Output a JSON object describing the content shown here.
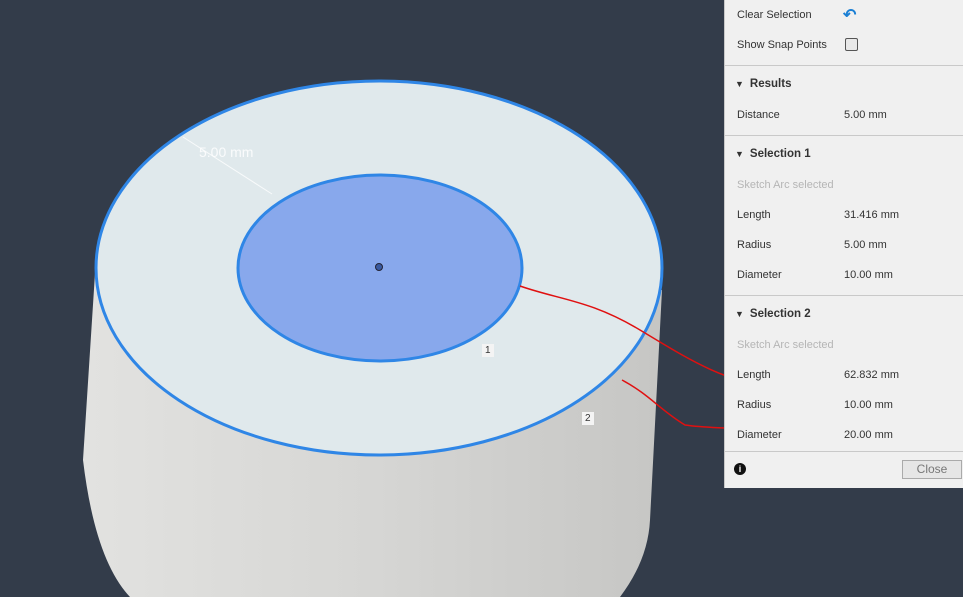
{
  "viewport": {
    "dimension_label": "5.00 mm",
    "edge_label_1": "1",
    "edge_label_2": "2",
    "accent": "#2f86e6"
  },
  "panel": {
    "clear_selection": "Clear Selection",
    "show_snap_points": "Show Snap Points",
    "show_snap_points_checked": false,
    "results": {
      "title": "Results",
      "distance_label": "Distance",
      "distance_value": "5.00 mm"
    },
    "selection1": {
      "title": "Selection 1",
      "status": "Sketch Arc selected",
      "length_label": "Length",
      "length_value": "31.416 mm",
      "radius_label": "Radius",
      "radius_value": "5.00 mm",
      "diameter_label": "Diameter",
      "diameter_value": "10.00 mm"
    },
    "selection2": {
      "title": "Selection 2",
      "status": "Sketch Arc selected",
      "length_label": "Length",
      "length_value": "62.832 mm",
      "radius_label": "Radius",
      "radius_value": "10.00 mm",
      "diameter_label": "Diameter",
      "diameter_value": "20.00 mm"
    },
    "info_icon": "i",
    "close_label": "Close"
  }
}
